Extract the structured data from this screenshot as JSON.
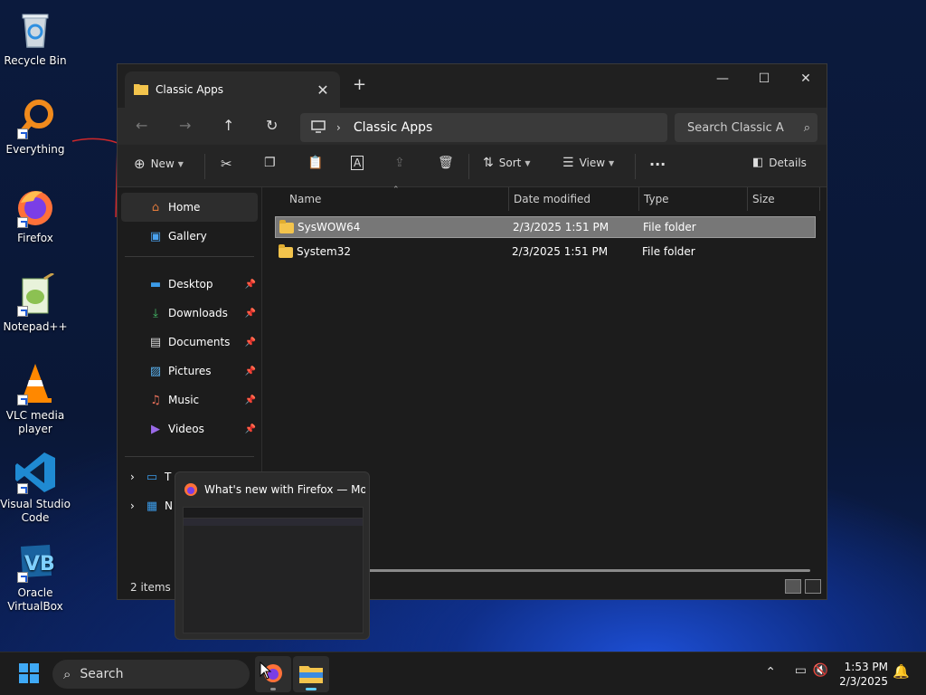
{
  "desktop": {
    "icons": [
      {
        "label": "Recycle Bin"
      },
      {
        "label": "Everything"
      },
      {
        "label": "Firefox"
      },
      {
        "label": "Notepad++"
      },
      {
        "label": "VLC media player"
      },
      {
        "label": "Visual Studio Code"
      },
      {
        "label": "Oracle VirtualBox"
      }
    ]
  },
  "explorer": {
    "tab_title": "Classic Apps",
    "address": {
      "crumb": "Classic Apps"
    },
    "search": {
      "placeholder": "Search Classic A"
    },
    "toolbar": {
      "new_label": "New",
      "sort_label": "Sort",
      "view_label": "View",
      "details_label": "Details"
    },
    "nav": {
      "home": "Home",
      "gallery": "Gallery",
      "quick_access": [
        {
          "label": "Desktop"
        },
        {
          "label": "Downloads"
        },
        {
          "label": "Documents"
        },
        {
          "label": "Pictures"
        },
        {
          "label": "Music"
        },
        {
          "label": "Videos"
        }
      ],
      "collapsed": [
        {
          "label": "T"
        },
        {
          "label": "N"
        }
      ]
    },
    "columns": {
      "name": "Name",
      "date": "Date modified",
      "type": "Type",
      "size": "Size"
    },
    "rows": [
      {
        "name": "SysWOW64",
        "date": "2/3/2025 1:51 PM",
        "type": "File folder",
        "size": ""
      },
      {
        "name": "System32",
        "date": "2/3/2025 1:51 PM",
        "type": "File folder",
        "size": ""
      }
    ],
    "status": {
      "count": "2 items"
    }
  },
  "preview": {
    "title": "What's new with Firefox — Moz..."
  },
  "taskbar": {
    "search_label": "Search",
    "clock": {
      "time": "1:53 PM",
      "date": "2/3/2025"
    }
  },
  "colors": {
    "accent": "#60cdff",
    "folder": "#f3c44c",
    "selection": "#777777"
  }
}
